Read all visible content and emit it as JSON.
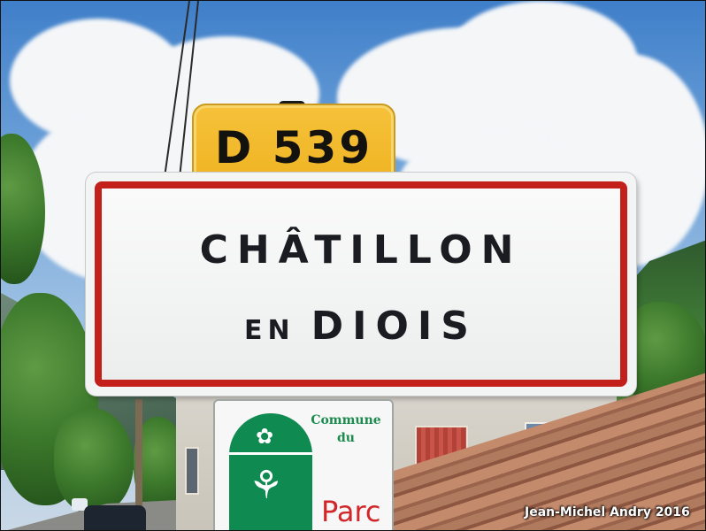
{
  "road_sign": {
    "text": "D 539"
  },
  "town_sign": {
    "line1": "CHÂTILLON",
    "line2_prefix": "EN",
    "line2_main": "DIOIS"
  },
  "park_sign": {
    "commune": "Commune",
    "du": "du",
    "parc": "Parc"
  },
  "credit": "Jean-Michel Andry 2016"
}
